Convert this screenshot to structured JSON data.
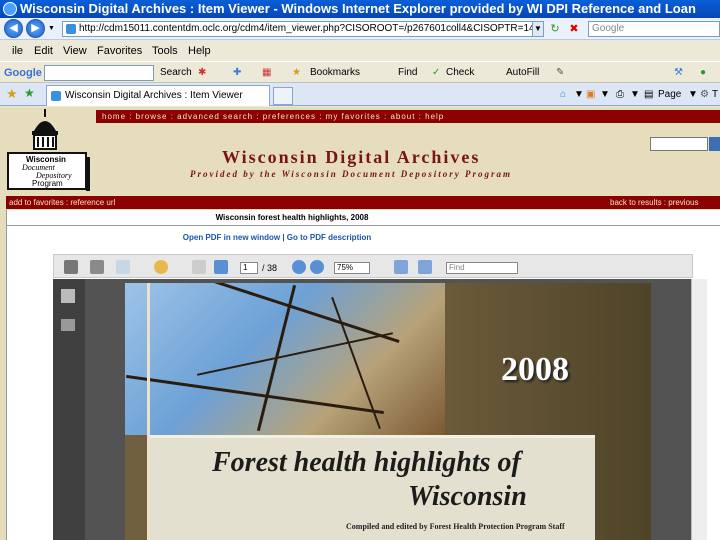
{
  "window": {
    "title": "Wisconsin Digital Archives : Item Viewer - Windows Internet Explorer provided by WI DPI Reference and Loan"
  },
  "address": {
    "url": "http://cdm15011.contentdm.oclc.org/cdm4/item_viewer.php?CISOROOT=/p267601coll4&CISOPTR=14",
    "search_placeholder": "Google"
  },
  "menu": {
    "items": [
      "ile",
      "Edit",
      "View",
      "Favorites",
      "Tools",
      "Help"
    ]
  },
  "google_toolbar": {
    "logo": "Google",
    "search_label": "Search",
    "bookmarks_label": "Bookmarks",
    "find_label": "Find",
    "check_label": "Check",
    "autofill_label": "AutoFill"
  },
  "tabs": {
    "active_label": "Wisconsin Digital Archives : Item Viewer",
    "page_label": "Page",
    "tools_label": "T"
  },
  "site": {
    "nav": "home : browse : advanced search : preferences : my favorites : about : help",
    "title": "Wisconsin Digital Archives",
    "subtitle": "Provided by the Wisconsin Document Depository Program",
    "logo_line1": "Wisconsin",
    "logo_line2": "Document",
    "logo_line3": "Depository",
    "logo_line4": "Program",
    "actions_left": "add to favorites : reference url",
    "actions_right": "back to results : previous"
  },
  "document": {
    "title": "Wisconsin forest health highlights, 2008",
    "links": "Open PDF in new window | Go to PDF description"
  },
  "pdf": {
    "page_current": "1",
    "page_total": "/ 38",
    "zoom": "75%",
    "find_placeholder": "Find"
  },
  "cover": {
    "year": "2008",
    "title_line1": "Forest health highlights of",
    "title_line2": "Wisconsin",
    "compiled": "Compiled and edited by Forest Health Protection Program Staff"
  }
}
